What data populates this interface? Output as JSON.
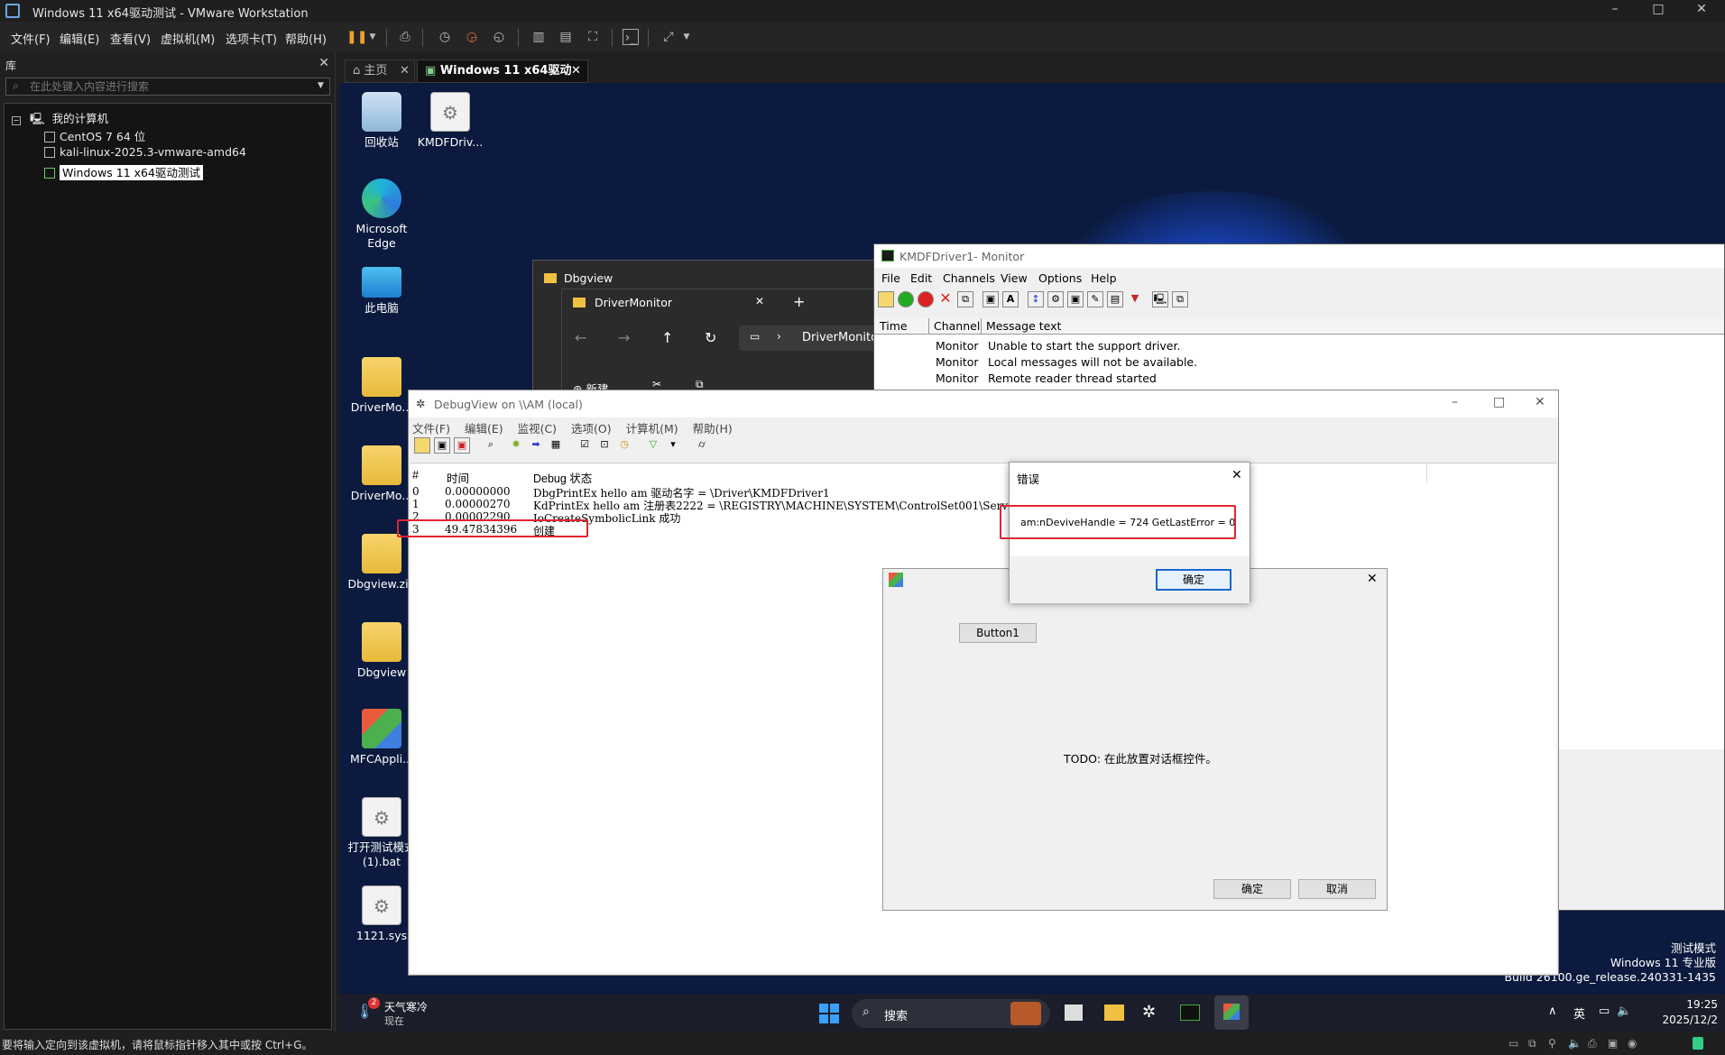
{
  "vm": {
    "title": "Windows 11 x64驱动测试 - VMware Workstation",
    "menu": [
      "文件(F)",
      "编辑(E)",
      "查看(V)",
      "虚拟机(M)",
      "选项卡(T)",
      "帮助(H)"
    ],
    "window_controls": [
      "–",
      "□",
      "✕"
    ]
  },
  "library": {
    "title": "库",
    "close": "✕",
    "search_placeholder": "在此处键入内容进行搜索",
    "root": "我的计算机",
    "vms": [
      "CentOS 7 64 位",
      "kali-linux-2025.3-vmware-amd64",
      "Windows 11 x64驱动测试"
    ]
  },
  "tabs": {
    "home": "主页",
    "active": "Windows 11 x64驱动测试",
    "close": "✕"
  },
  "desktop_icons": [
    {
      "label": "回收站"
    },
    {
      "label": "KMDFDriv..."
    },
    {
      "label": "Microsoft Edge"
    },
    {
      "label": "此电脑"
    },
    {
      "label": "DriverMo..."
    },
    {
      "label": "DriverMo..."
    },
    {
      "label": "Dbgview.zip"
    },
    {
      "label": "Dbgview"
    },
    {
      "label": "MFCAppli..."
    },
    {
      "label": "打开测试模式(1).bat"
    },
    {
      "label": "1121.sys"
    }
  ],
  "kmdf_monitor": {
    "title": "KMDFDriver1- Monitor",
    "menu": [
      "File",
      "Edit",
      "Channels",
      "View",
      "Options",
      "Help"
    ],
    "columns": [
      "Time",
      "Channel",
      "Message text"
    ],
    "rows": [
      {
        "channel": "Monitor",
        "message": "Unable to start the support driver."
      },
      {
        "channel": "Monitor",
        "message": "Local messages will not be available."
      },
      {
        "channel": "Monitor",
        "message": "Remote reader thread started"
      }
    ]
  },
  "explorer_back": {
    "title": "Dbgview"
  },
  "explorer": {
    "title": "DriverMonitor",
    "crumb": "DriverMonito",
    "new_label": "新建",
    "close": "✕",
    "add": "+"
  },
  "debugview": {
    "title": "DebugView on \\\\AM (local)",
    "menu": [
      "文件(F)",
      "编辑(E)",
      "监视(C)",
      "选项(O)",
      "计算机(M)",
      "帮助(H)"
    ],
    "columns": [
      "#",
      "时间",
      "Debug 状态"
    ],
    "rows": [
      {
        "n": "0",
        "time": "0.00000000",
        "msg": "DbgPrintEx hello am 驱动名字 = \\Driver\\KMDFDriver1"
      },
      {
        "n": "1",
        "time": "0.00000270",
        "msg": "KdPrintEx hello am 注册表2222 = \\REGISTRY\\MACHINE\\SYSTEM\\ControlSet001\\Servi"
      },
      {
        "n": "2",
        "time": "0.00002290",
        "msg": "IoCreateSymbolicLink 成功"
      },
      {
        "n": "3",
        "time": "49.47834396",
        "msg": "创建"
      }
    ]
  },
  "mfc_dialog": {
    "button1": "Button1",
    "todo": "TODO: 在此放置对话框控件。",
    "ok": "确定",
    "cancel": "取消",
    "close": "✕"
  },
  "error_dialog": {
    "title": "错误",
    "message": "am:nDeviveHandle = 724 GetLastError = 0",
    "ok": "确定",
    "close": "✕"
  },
  "watermark": {
    "line1": "测试模式",
    "line2": "Windows 11 专业版",
    "line3": "Build 26100.ge_release.240331-1435"
  },
  "taskbar": {
    "weather_title": "天气寒冷",
    "weather_sub": "现在",
    "weather_badge": "2",
    "search": "搜索",
    "ime": "英",
    "time": "19:25",
    "date": "2025/12/2"
  },
  "status": {
    "text": "要将输入定向到该虚拟机，请将鼠标指针移入其中或按 Ctrl+G。"
  },
  "colors": {
    "accent_red": "#e0252f",
    "vm_dark": "#1f1f1f",
    "desktop": "#0b1a3e"
  }
}
